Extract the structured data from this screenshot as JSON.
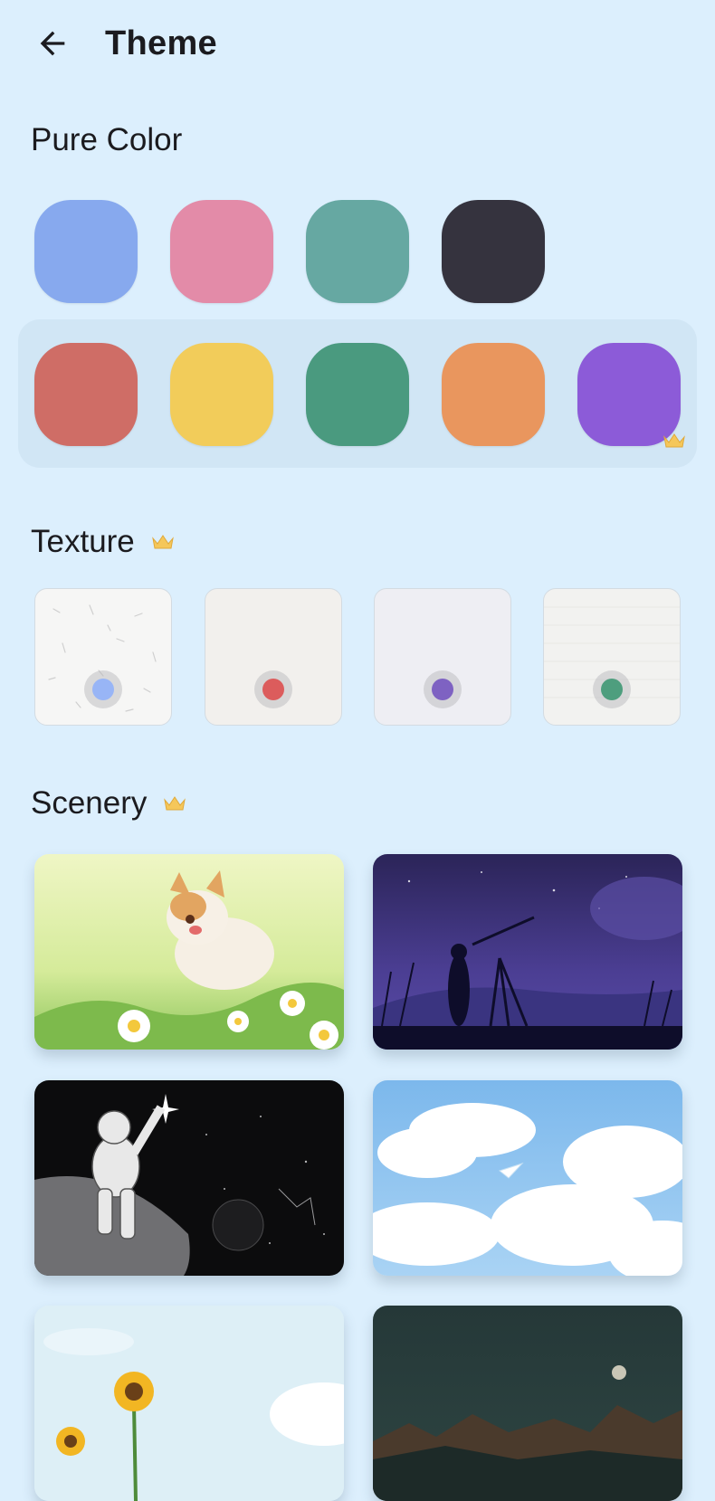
{
  "header": {
    "title": "Theme"
  },
  "pure_color": {
    "title": "Pure Color",
    "row1": [
      "#87A9EE",
      "#E38BA8",
      "#66A8A2",
      "#35333E"
    ],
    "row2": [
      "#CF6D66",
      "#F2CC5A",
      "#4A9A7F",
      "#E9965E",
      "#8C5BD8"
    ]
  },
  "texture": {
    "title": "Texture",
    "dot_colors": [
      "#98B5F6",
      "#DC5C5C",
      "#7E62C2",
      "#4E9E7E"
    ]
  },
  "scenery": {
    "title": "Scenery"
  }
}
